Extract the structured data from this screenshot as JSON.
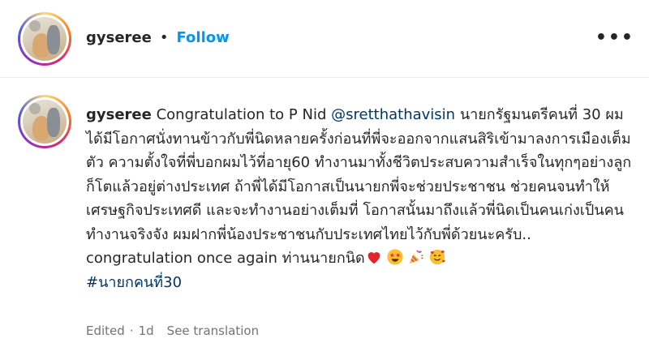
{
  "post": {
    "username": "gyseree",
    "separator": "•",
    "follow_label": "Follow",
    "more_label": "•••"
  },
  "caption": {
    "username": "gyseree",
    "text_before_mention": "Congratulation to P Nid",
    "mention": "@sretthathavisin",
    "text_after_mention": "นายกรัฐมนตรีคนที่ 30 ผมได้มีโอกาศนั่งทานข้าวกับพี่นิดหลายครั้งก่อนที่พี่จะออกจากแสนสิริเข้ามาลงการเมืองเต็มตัว ความตั้งใจที่พี่บอกผมไว้ที่อายุ60 ทำงานมาทั้งชีวิตประสบความสำเร็จในทุกๆอย่างลูกก็โตแล้วอยู่ต่างประเทศ ถ้าพี่ได้มีโอกาสเป็นนายกพี่จะช่วยประชาชน ช่วยคนจนทำให้เศรษฐกิจประเทศดี และจะทำงานอย่างเต็มที่ โอกาสนั้นมาถึงแล้วพี่นิดเป็นคนเก่งเป็นคนทำงานจริงจัง ผมฝากพี่น้องประชาชนกับประเทศไทยไว้กับพี่ด้วยนะครับ.. congratulation once again ท่านนายกนิด",
    "emoji_icons": [
      "red-heart-icon",
      "star-struck-face-icon",
      "party-popper-icon",
      "smiling-face-with-hearts-icon"
    ],
    "hashtag": "#นายกคนที่30"
  },
  "meta": {
    "edited": "Edited",
    "separator": "·",
    "age": "1d",
    "see_translation": "See translation"
  },
  "colors": {
    "link_blue": "#0095f6",
    "mention_blue": "#00376b",
    "text": "#262626",
    "muted": "#737373"
  }
}
